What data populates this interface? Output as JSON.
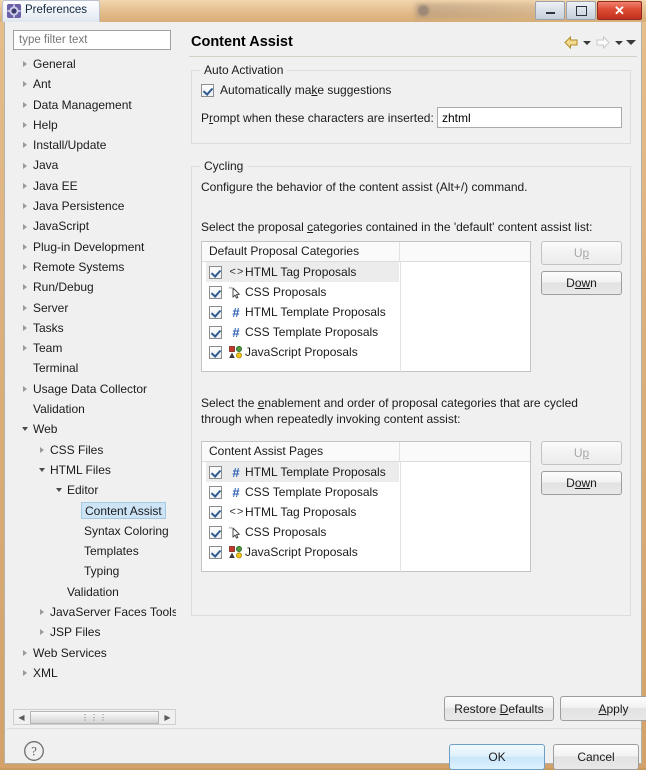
{
  "window": {
    "title": "Preferences",
    "icon": "preferences-gear-icon",
    "buttons": {
      "minimize": "minimize-icon",
      "maximize": "maximize-icon",
      "close": "✕"
    }
  },
  "sidebar": {
    "filter": {
      "placeholder": "type filter text",
      "value": ""
    },
    "items": [
      {
        "label": "General",
        "indent": 0,
        "state": "collapsed"
      },
      {
        "label": "Ant",
        "indent": 0,
        "state": "collapsed"
      },
      {
        "label": "Data Management",
        "indent": 0,
        "state": "collapsed"
      },
      {
        "label": "Help",
        "indent": 0,
        "state": "collapsed"
      },
      {
        "label": "Install/Update",
        "indent": 0,
        "state": "collapsed"
      },
      {
        "label": "Java",
        "indent": 0,
        "state": "collapsed"
      },
      {
        "label": "Java EE",
        "indent": 0,
        "state": "collapsed"
      },
      {
        "label": "Java Persistence",
        "indent": 0,
        "state": "collapsed"
      },
      {
        "label": "JavaScript",
        "indent": 0,
        "state": "collapsed"
      },
      {
        "label": "Plug-in Development",
        "indent": 0,
        "state": "collapsed"
      },
      {
        "label": "Remote Systems",
        "indent": 0,
        "state": "collapsed"
      },
      {
        "label": "Run/Debug",
        "indent": 0,
        "state": "collapsed"
      },
      {
        "label": "Server",
        "indent": 0,
        "state": "collapsed"
      },
      {
        "label": "Tasks",
        "indent": 0,
        "state": "collapsed"
      },
      {
        "label": "Team",
        "indent": 0,
        "state": "collapsed"
      },
      {
        "label": "Terminal",
        "indent": 0,
        "state": "leaf"
      },
      {
        "label": "Usage Data Collector",
        "indent": 0,
        "state": "collapsed"
      },
      {
        "label": "Validation",
        "indent": 0,
        "state": "leaf"
      },
      {
        "label": "Web",
        "indent": 0,
        "state": "expanded"
      },
      {
        "label": "CSS Files",
        "indent": 1,
        "state": "collapsed"
      },
      {
        "label": "HTML Files",
        "indent": 1,
        "state": "expanded"
      },
      {
        "label": "Editor",
        "indent": 2,
        "state": "expanded"
      },
      {
        "label": "Content Assist",
        "indent": 3,
        "state": "leaf",
        "selected": true
      },
      {
        "label": "Syntax Coloring",
        "indent": 3,
        "state": "leaf"
      },
      {
        "label": "Templates",
        "indent": 3,
        "state": "leaf"
      },
      {
        "label": "Typing",
        "indent": 3,
        "state": "leaf"
      },
      {
        "label": "Validation",
        "indent": 2,
        "state": "leaf"
      },
      {
        "label": "JavaServer Faces Tools",
        "indent": 1,
        "state": "collapsed"
      },
      {
        "label": "JSP Files",
        "indent": 1,
        "state": "collapsed"
      },
      {
        "label": "Web Services",
        "indent": 0,
        "state": "collapsed"
      },
      {
        "label": "XML",
        "indent": 0,
        "state": "collapsed"
      }
    ],
    "hscroll": {
      "left": "◀",
      "right": "▶",
      "grip": "⋮⋮⋮"
    }
  },
  "page": {
    "title": "Content Assist",
    "nav": {
      "back": "back-arrow-icon",
      "forward": "forward-arrow-icon",
      "menu": "view-menu-icon"
    },
    "auto_activation": {
      "caption": "Auto Activation",
      "auto_suggest": {
        "label": "Automatically make suggestions",
        "checked": true
      },
      "prompt": {
        "label_before": "P",
        "label_accel": "r",
        "label_after": "ompt when these characters are inserted:",
        "full_label": "Prompt when these characters are inserted:",
        "value": "zhtml"
      }
    },
    "cycling": {
      "caption": "Cycling",
      "description": "Configure the behavior of the content assist (Alt+/) command.",
      "default_list": {
        "instruction": "Select the proposal categories contained in the 'default' content assist list:",
        "header": "Default Proposal Categories",
        "rows": [
          {
            "label": "HTML Tag Proposals",
            "checked": true,
            "icon": "html-tag-icon",
            "selected": true
          },
          {
            "label": "CSS Proposals",
            "checked": true,
            "icon": "css-cursor-icon",
            "selected": false
          },
          {
            "label": "HTML Template Proposals",
            "checked": true,
            "icon": "template-hash-icon",
            "selected": false
          },
          {
            "label": "CSS Template Proposals",
            "checked": true,
            "icon": "template-hash-icon",
            "selected": false
          },
          {
            "label": "JavaScript Proposals",
            "checked": true,
            "icon": "javascript-icon",
            "selected": false
          }
        ],
        "up_label": "Up",
        "down_label": "Down",
        "up_enabled": false,
        "down_enabled": true
      },
      "pages_list": {
        "instruction_line1": "Select the enablement and order of proposal categories that are cycled",
        "instruction_line2": "through when repeatedly invoking content assist:",
        "header": "Content Assist Pages",
        "rows": [
          {
            "label": "HTML Template Proposals",
            "checked": true,
            "icon": "template-hash-icon",
            "selected": true
          },
          {
            "label": "CSS Template Proposals",
            "checked": true,
            "icon": "template-hash-icon",
            "selected": false
          },
          {
            "label": "HTML Tag Proposals",
            "checked": true,
            "icon": "html-tag-icon",
            "selected": false
          },
          {
            "label": "CSS Proposals",
            "checked": true,
            "icon": "css-cursor-icon",
            "selected": false
          },
          {
            "label": "JavaScript Proposals",
            "checked": true,
            "icon": "javascript-icon",
            "selected": false
          }
        ],
        "up_label": "Up",
        "down_label": "Down",
        "up_enabled": false,
        "down_enabled": true
      }
    }
  },
  "footer": {
    "restore_defaults": "Restore Defaults",
    "apply": "Apply",
    "ok": "OK",
    "cancel": "Cancel",
    "help": "help-question-icon"
  },
  "colors": {
    "selection_blue": "#cde4f7",
    "accent_hash": "#2f62b3",
    "close_red": "#c02f1c",
    "title_tan": "#e3bc8b"
  }
}
